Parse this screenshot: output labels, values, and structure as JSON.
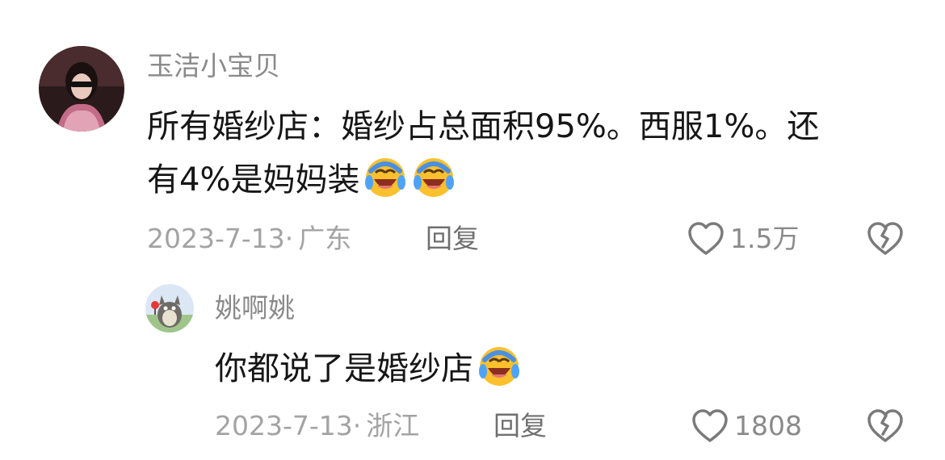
{
  "comments": [
    {
      "author": "玉洁小宝贝",
      "text_line1": "所有婚纱店：婚纱占总面积95%。西服1%。还",
      "text_line2": "有4%是妈妈装",
      "text_emojis": [
        "laughing-crying-emoji",
        "laughing-crying-emoji"
      ],
      "date": "2023-7-13",
      "separator": "·",
      "location": "广东",
      "reply_label": "回复",
      "likes": "1.5万"
    },
    {
      "author": "姚啊姚",
      "text": "你都说了是婚纱店",
      "text_emojis": [
        "laughing-crying-emoji"
      ],
      "date": "2023-7-13",
      "separator": "·",
      "location": "浙江",
      "reply_label": "回复",
      "likes": "1808"
    }
  ],
  "icons": {
    "like": "heart-outline-icon",
    "dislike": "broken-heart-icon"
  },
  "colors": {
    "author": "#8a8a8a",
    "text": "#161616",
    "meta": "#a3a3a3",
    "reply": "#6f6f6f",
    "icon": "#7a7a7a"
  }
}
